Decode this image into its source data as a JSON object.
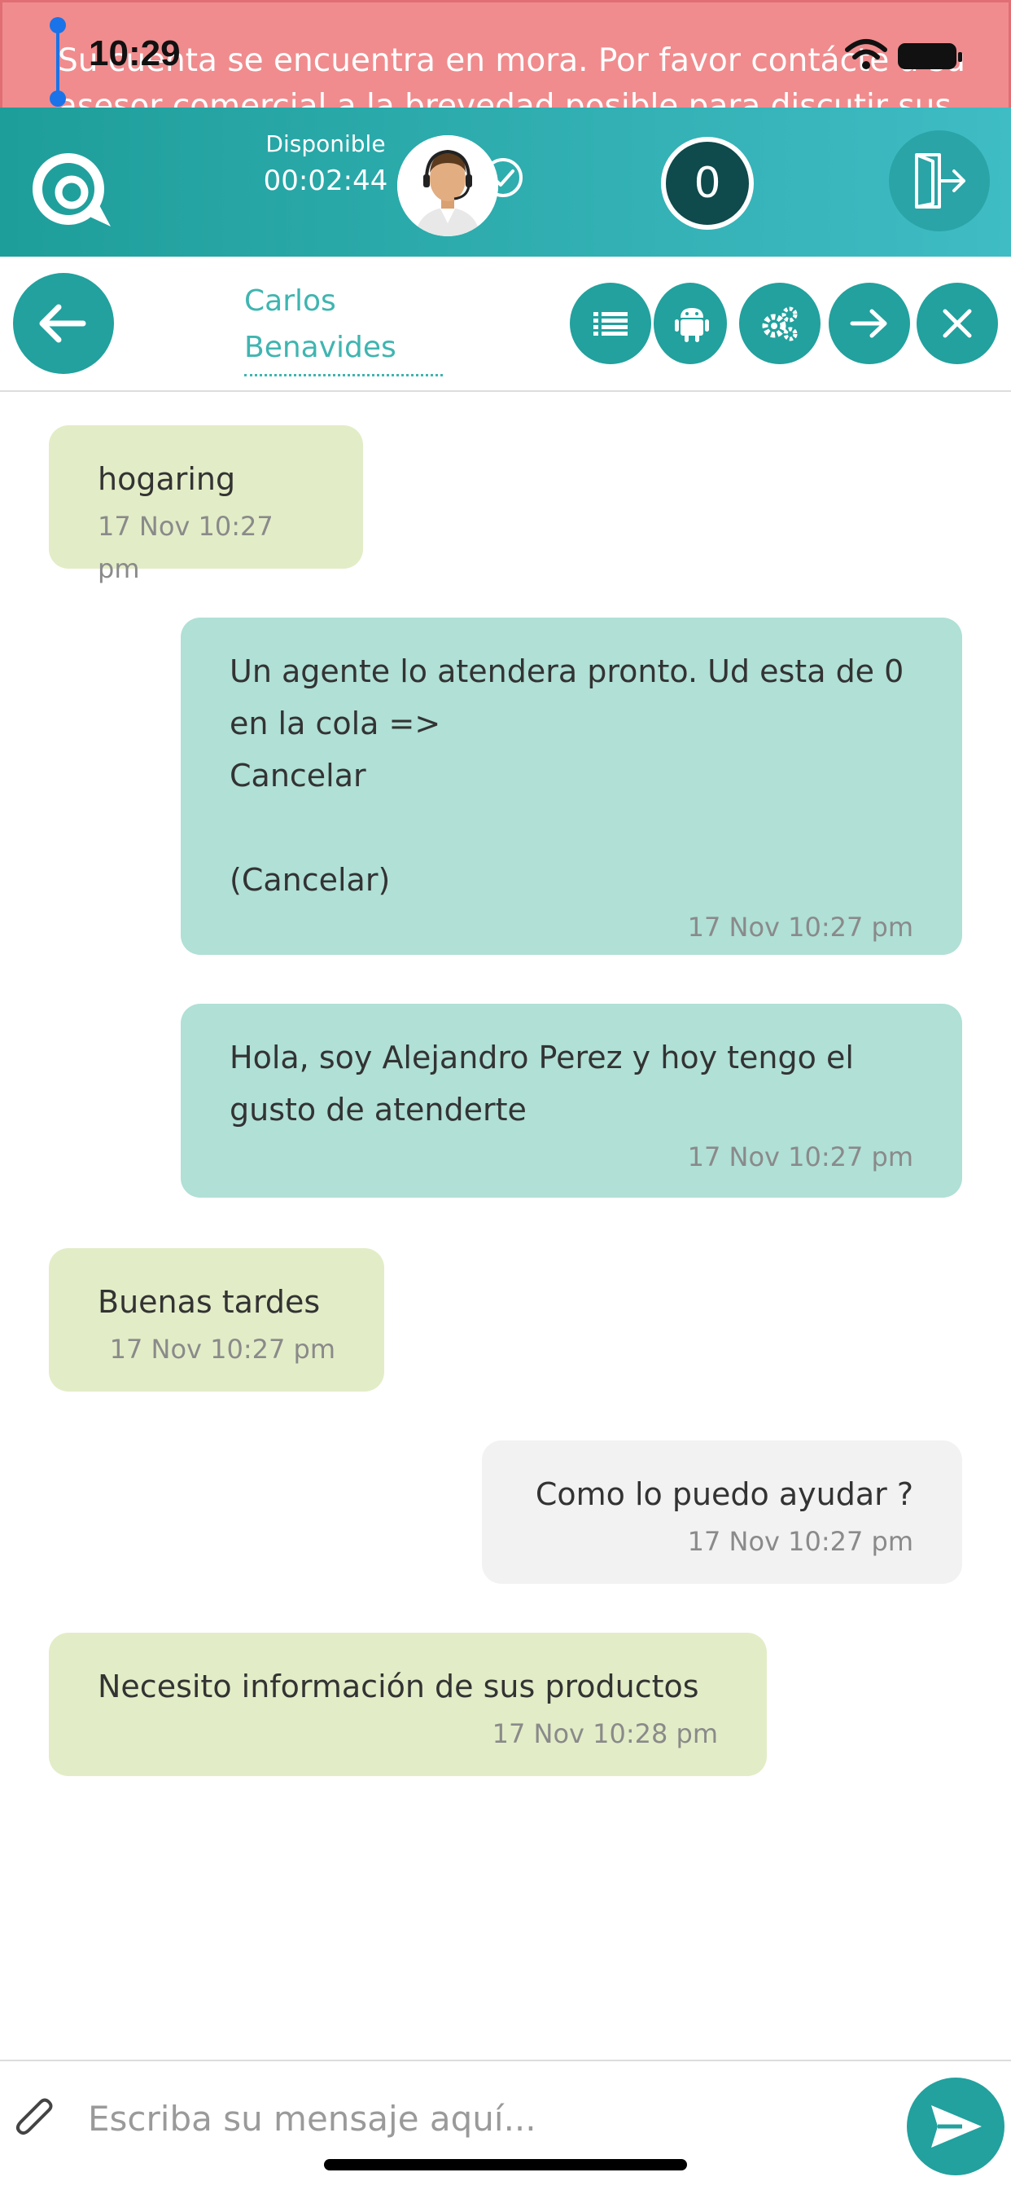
{
  "status_bar": {
    "time": "10:29"
  },
  "banner": {
    "text": "Su cuenta se encuentra en mora. Por favor contácte a su asesor comercial a la brevedad posible para discutir sus"
  },
  "header": {
    "agent_status": "Disponible",
    "timer": "00:02:44",
    "queue_count": "0",
    "icons": {
      "logo": "brand-logo-icon",
      "avatar": "agent-avatar",
      "verified": "check-circle-icon",
      "logout": "logout-icon"
    }
  },
  "toolbar": {
    "contact_name": "Carlos Benavides",
    "icons": [
      "back-arrow-icon",
      "list-icon",
      "android-icon",
      "cogs-icon",
      "forward-arrow-icon",
      "close-icon"
    ]
  },
  "colors": {
    "teal": "#22a19e",
    "incoming_bubble": "#e2edc7",
    "outgoing_bubble": "#b0e0d6",
    "neutral_bubble": "#f2f2f2",
    "banner": "#f08c8e"
  },
  "messages": [
    {
      "text": "hogaring",
      "time": "17 Nov 10:27 pm",
      "side": "left"
    },
    {
      "text": "Un agente lo atendera pronto. Ud esta de 0\nen la cola =>\nCancelar\n\n(Cancelar)",
      "time": "17 Nov 10:27 pm",
      "side": "right"
    },
    {
      "text": "Hola, soy Alejandro Perez y hoy tengo el\ngusto de atenderte",
      "time": "17 Nov 10:27 pm",
      "side": "right"
    },
    {
      "text": "Buenas tardes",
      "time": "17 Nov 10:27 pm",
      "side": "left"
    },
    {
      "text": "Como lo puedo ayudar ?",
      "time": "17 Nov 10:27 pm",
      "side": "right"
    },
    {
      "text": "Necesito información de sus productos",
      "time": "17 Nov 10:28 pm",
      "side": "left"
    }
  ],
  "composer": {
    "placeholder": "Escriba su mensaje aquí...",
    "value": "",
    "icons": {
      "attach": "paperclip-icon",
      "send": "send-icon"
    }
  }
}
